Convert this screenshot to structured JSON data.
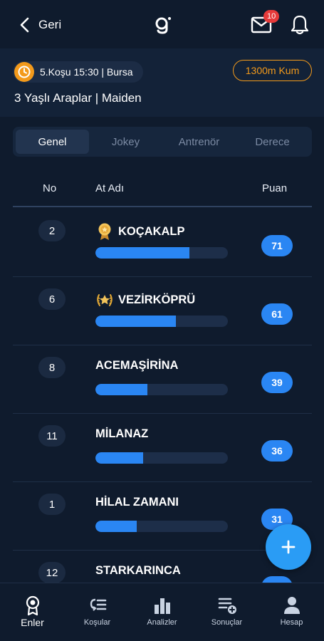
{
  "header": {
    "back_label": "Geri",
    "mail_badge": "10",
    "icons": {
      "back": "chevron-left-icon",
      "logo": "app-logo",
      "mail": "mail-icon",
      "bell": "bell-icon"
    }
  },
  "race": {
    "chip_text": "5.Koşu 15:30 | Bursa",
    "track": "1300m Kum",
    "description": "3 Yaşlı Araplar | Maiden",
    "colors": {
      "accent": "#f39a1b"
    }
  },
  "tabs": [
    {
      "label": "Genel",
      "active": true
    },
    {
      "label": "Jokey",
      "active": false
    },
    {
      "label": "Antrenör",
      "active": false
    },
    {
      "label": "Derece",
      "active": false
    }
  ],
  "table": {
    "headers": {
      "no": "No",
      "name": "At Adı",
      "score": "Puan"
    },
    "rows": [
      {
        "no": "2",
        "name": "KOÇAKALP",
        "score": "71",
        "bar_fraction": 0.71,
        "medal": "ribbon-medal-icon"
      },
      {
        "no": "6",
        "name": "VEZİRKÖPRÜ",
        "score": "61",
        "bar_fraction": 0.61,
        "medal": "star-laurel-icon"
      },
      {
        "no": "8",
        "name": "ACEMAŞİRİNA",
        "score": "39",
        "bar_fraction": 0.39
      },
      {
        "no": "11",
        "name": "MİLANAZ",
        "score": "36",
        "bar_fraction": 0.36
      },
      {
        "no": "1",
        "name": "HİLAL ZAMANI",
        "score": "31",
        "bar_fraction": 0.31
      },
      {
        "no": "12",
        "name": "STARKARINCA",
        "score": "",
        "bar_fraction": 0
      }
    ],
    "colors": {
      "bar": "#2a86f3",
      "track": "#1d2e49"
    }
  },
  "fab": {
    "icon": "plus-icon"
  },
  "bottom_nav": [
    {
      "label": "Enler",
      "icon": "award-icon",
      "active": true
    },
    {
      "label": "Koşular",
      "icon": "list-icon",
      "active": false
    },
    {
      "label": "Analizler",
      "icon": "bar-chart-icon",
      "active": false
    },
    {
      "label": "Sonuçlar",
      "icon": "list-add-icon",
      "active": false
    },
    {
      "label": "Hesap",
      "icon": "user-icon",
      "active": false
    }
  ]
}
